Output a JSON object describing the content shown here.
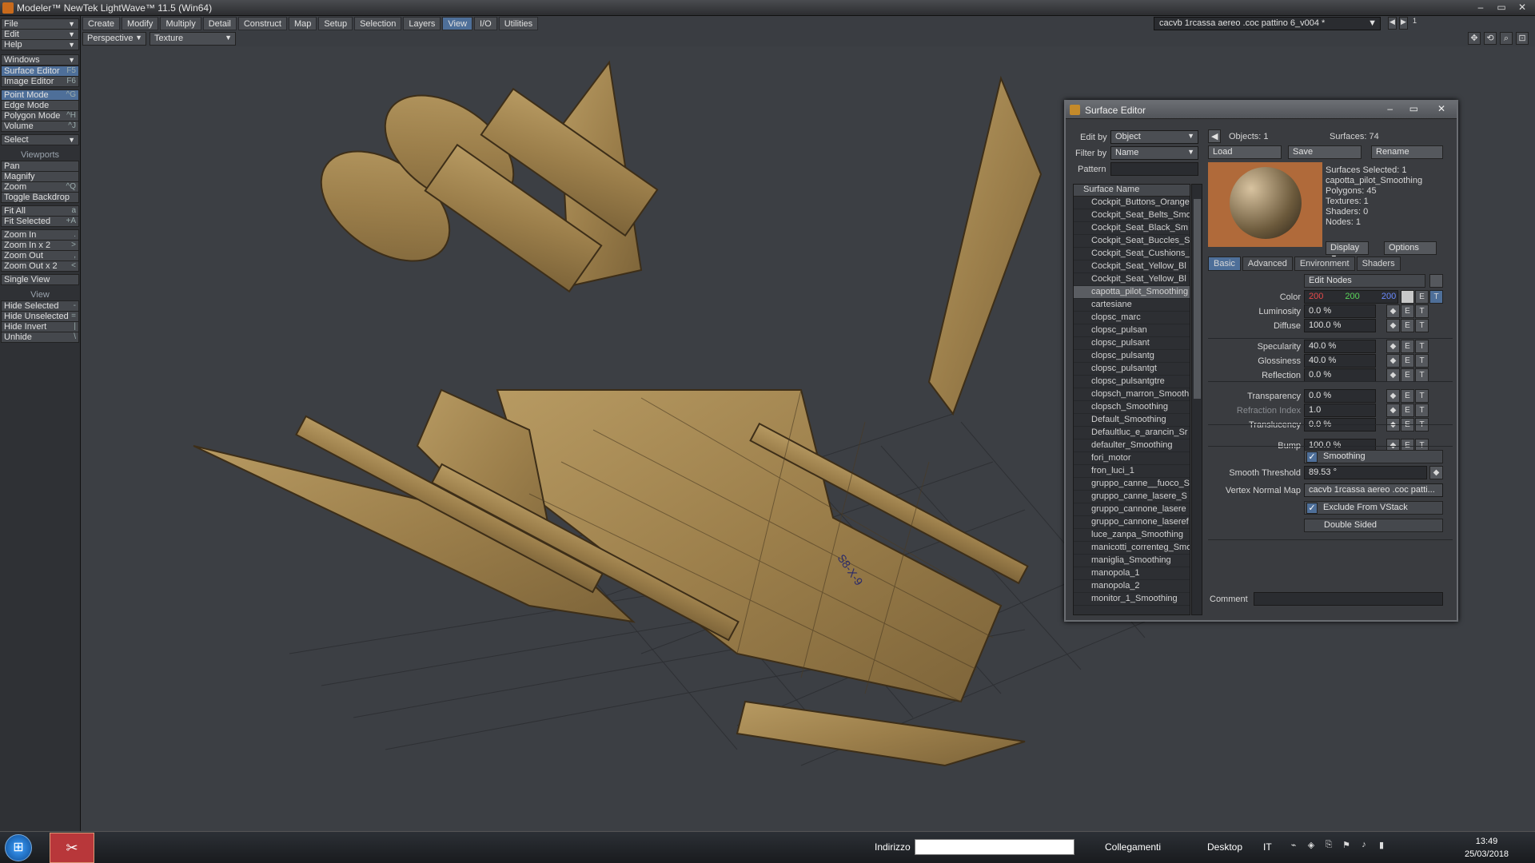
{
  "window": {
    "title": "Modeler™ NewTek LightWave™ 11.5 (Win64)",
    "btn_min": "–",
    "btn_max": "▭",
    "btn_close": "✕"
  },
  "menu": [
    "Create",
    "Modify",
    "Multiply",
    "Detail",
    "Construct",
    "Map",
    "Setup",
    "Selection",
    "Layers",
    "View",
    "I/O",
    "Utilities"
  ],
  "menu_active": "View",
  "object_selector": "cacvb 1rcassa aereo .coc pattino 6_v004 *",
  "layer_nav": {
    "prev": "◀",
    "next": "▶",
    "number": "1"
  },
  "viewbar": {
    "view": "Perspective",
    "shading": "Texture"
  },
  "view_icons": [
    "move-view-icon",
    "rotate-view-icon",
    "zoom-view-icon",
    "maximize-view-icon"
  ],
  "view_icon_glyphs": [
    "✥",
    "⟲",
    "⌕",
    "⊡"
  ],
  "left_panel": {
    "top_menus": [
      {
        "label": "File"
      },
      {
        "label": "Edit"
      },
      {
        "label": "Help"
      },
      {
        "label": "Windows"
      }
    ],
    "editors": [
      {
        "label": "Surface Editor",
        "key": "F5"
      },
      {
        "label": "Image Editor",
        "key": "F6"
      }
    ],
    "modes": [
      {
        "label": "Point Mode",
        "key": "^G",
        "active": true
      },
      {
        "label": "Edge Mode",
        "key": ""
      },
      {
        "label": "Polygon Mode",
        "key": "^H"
      },
      {
        "label": "Volume",
        "key": "^J"
      }
    ],
    "select": "Select",
    "viewports_title": "Viewports",
    "viewports": [
      {
        "label": "Pan",
        "key": ""
      },
      {
        "label": "Magnify",
        "key": ""
      },
      {
        "label": "Zoom",
        "key": "^Q"
      },
      {
        "label": "Toggle Backdrop",
        "key": ""
      }
    ],
    "fit": [
      {
        "label": "Fit All",
        "key": "a"
      },
      {
        "label": "Fit Selected",
        "key": "+A"
      }
    ],
    "zoom": [
      {
        "label": "Zoom In",
        "key": "."
      },
      {
        "label": "Zoom In x 2",
        "key": ">"
      },
      {
        "label": "Zoom Out",
        "key": ","
      },
      {
        "label": "Zoom Out x 2",
        "key": "<"
      }
    ],
    "single_view": "Single View",
    "view_title": "View",
    "view_items": [
      {
        "label": "Hide Selected",
        "key": "-"
      },
      {
        "label": "Hide Unselected",
        "key": "="
      },
      {
        "label": "Hide Invert",
        "key": "|"
      },
      {
        "label": "Unhide",
        "key": "\\"
      }
    ]
  },
  "viewport_label": "S8-X-9",
  "surface_editor": {
    "title": "Surface Editor",
    "edit_by_label": "Edit by",
    "edit_by": "Object",
    "filter_by_label": "Filter by",
    "filter_by": "Name",
    "pattern_label": "Pattern",
    "pattern": "",
    "collapse_btn": "◀",
    "objects": "Objects: 1",
    "surfaces": "Surfaces: 74",
    "load": "Load",
    "save": "Save",
    "rename": "Rename",
    "list_header": "Surface Name",
    "surfaces_list": [
      "Cockpit_Buttons_Orange",
      "Cockpit_Seat_Belts_Smo",
      "Cockpit_Seat_Black_Sm",
      "Cockpit_Seat_Buccles_S",
      "Cockpit_Seat_Cushions_",
      "Cockpit_Seat_Yellow_Bl",
      "Cockpit_Seat_Yellow_Bl",
      "capotta_pilot_Smoothing",
      "cartesiane",
      "clopsc_marc",
      "clopsc_pulsan",
      "clopsc_pulsant",
      "clopsc_pulsantg",
      "clopsc_pulsantgt",
      "clopsc_pulsantgtre",
      "clopsch_marron_Smooth",
      "clopsch_Smoothing",
      "Default_Smoothing",
      "Defaultluc_e_arancin_Sr",
      "defaulter_Smoothing",
      "fori_motor",
      "fron_luci_1",
      "gruppo_canne__fuoco_S",
      "gruppo_canne_lasere_S",
      "gruppo_cannone_lasere",
      "gruppo_cannone_laseref",
      "luce_zanpa_Smoothing",
      "manicotti_correnteg_Smo",
      "maniglia_Smoothing",
      "manopola_1",
      "manopola_2",
      "monitor_1_Smoothing"
    ],
    "selected_surface": "capotta_pilot_Smoothing",
    "info": [
      "Surfaces Selected: 1",
      "capotta_pilot_Smoothing",
      "Polygons: 45",
      "Textures: 1",
      "Shaders: 0",
      "Nodes: 1"
    ],
    "display": "Display",
    "options": "Options",
    "tabs": [
      "Basic",
      "Advanced",
      "Environment",
      "Shaders"
    ],
    "tab_active": "Basic",
    "edit_nodes": "Edit Nodes",
    "color_label": "Color",
    "color_r": "200",
    "color_g": "200",
    "color_b": "200",
    "color_swatch": "#c8c8c8",
    "env_glyph": "◆",
    "e_glyph": "E",
    "t_glyph": "T",
    "props": [
      {
        "label": "Luminosity",
        "value": "0.0 %"
      },
      {
        "label": "Diffuse",
        "value": "100.0 %"
      },
      {
        "label": "Specularity",
        "value": "40.0 %"
      },
      {
        "label": "Glossiness",
        "value": "40.0 %"
      },
      {
        "label": "Reflection",
        "value": "0.0 %"
      },
      {
        "label": "Transparency",
        "value": "0.0 %"
      },
      {
        "label": "Refraction Index",
        "value": "1.0"
      },
      {
        "label": "Translucency",
        "value": "0.0 %"
      },
      {
        "label": "Bump",
        "value": "100.0 %"
      }
    ],
    "smoothing": "Smoothing",
    "smooth_threshold_label": "Smooth Threshold",
    "smooth_threshold": "89.53 °",
    "vertex_normal_label": "Vertex Normal Map",
    "vertex_normal": "cacvb 1rcassa aereo .coc patti...",
    "exclude_vstack": "Exclude From VStack",
    "double_sided": "Double Sided",
    "comment_label": "Comment",
    "comment": ""
  },
  "taskbar": {
    "start_glyph": "⊞",
    "app_glyph": "✂",
    "address_label": "Indirizzo",
    "address_value": "",
    "links": "Collegamenti",
    "desktop": "Desktop",
    "lang": "IT",
    "time": "13:49",
    "date": "25/03/2018"
  },
  "colors": {
    "accent": "#4e6f99",
    "aircraft": "#a88a55",
    "grid": "#2b2d31"
  }
}
